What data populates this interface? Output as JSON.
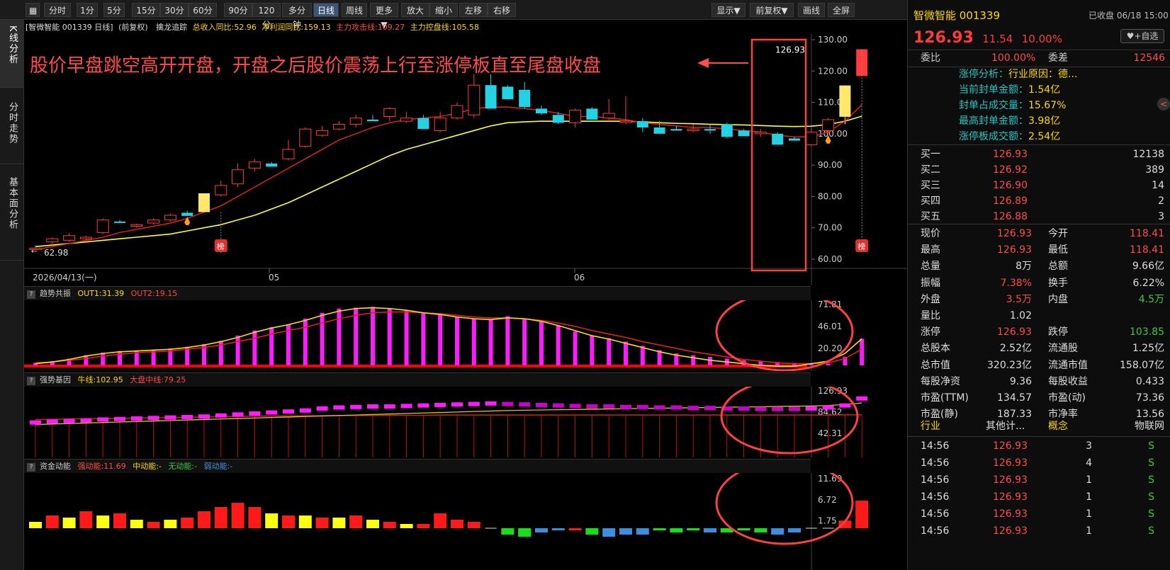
{
  "toolbar": {
    "buttons": [
      "分时",
      "1分",
      "5分",
      "15分",
      "30分",
      "60分",
      "90分",
      "120分",
      "多分钟",
      "日线",
      "周线",
      "更多▼",
      "放大",
      "缩小",
      "左移",
      "右移"
    ],
    "right_buttons": [
      "显示▼",
      "前复权▼",
      "画线",
      "全屏"
    ]
  },
  "nav": {
    "items": [
      "K线分析",
      "分时走势",
      "基本面分析"
    ]
  },
  "main_panel": {
    "info_label": "[智微智能 001339 日线]",
    "fuquan": "(前复权)",
    "indicator_name": "擒龙追踪",
    "ind1": "总收入同比:52.96",
    "ind2": "净利润同比:159.13",
    "ind3": "主力攻击线:109.27",
    "ind4": "主力控盘线:105.58",
    "annotation": "股价早盘跳空高开开盘，开盘之后股价震荡上行至涨停板直至尾盘收盘",
    "last_price_tag": "126.93",
    "low_tag": "62.98",
    "bang": "榜",
    "y_labels": [
      "130.00",
      "120.00",
      "110.00",
      "100.00",
      "90.00",
      "80.00",
      "70.00",
      "60.00"
    ],
    "x_labels": [
      "2026/04/13(一)",
      "05",
      "06"
    ]
  },
  "panel2": {
    "name": "趋势共振",
    "v1": "OUT1:31.39",
    "v2": "OUT2:19.15",
    "y_labels": [
      "71.81",
      "46.01",
      "20.20"
    ]
  },
  "panel3": {
    "name": "强势基因",
    "v1": "牛线:102.95",
    "v2": "大盘中线:79.25",
    "y_labels": [
      "126.93",
      "84.62",
      "42.31"
    ]
  },
  "panel4": {
    "name": "资金动能",
    "v1": "强动能:11.69",
    "v2": "中动能:-",
    "v3": "无动能:-",
    "v4": "弱动能:-",
    "y_labels": [
      "11.69",
      "6.72",
      "1.75"
    ]
  },
  "right": {
    "name": "智微智能",
    "code": "001339",
    "status": "已收盘 06/18 15:00",
    "price": "126.93",
    "change": "11.54",
    "pct": "10.00%",
    "add_btn": "+自选",
    "weibi_label": "委比",
    "weibi": "100.00%",
    "weicha_label": "委差",
    "weicha": "12546",
    "limit_analysis": [
      {
        "label": "涨停分析：",
        "value": "行业原因：德..."
      },
      {
        "label": "当前封单金额：",
        "value": "1.54亿"
      },
      {
        "label": "封单占成交量：",
        "value": "15.67%"
      },
      {
        "label": "最高封单金额：",
        "value": "3.98亿"
      },
      {
        "label": "涨停板成交额：",
        "value": "2.54亿"
      }
    ],
    "bids": [
      {
        "label": "买一",
        "price": "126.93",
        "vol": "12138"
      },
      {
        "label": "买二",
        "price": "126.92",
        "vol": "389"
      },
      {
        "label": "买三",
        "price": "126.90",
        "vol": "14"
      },
      {
        "label": "买四",
        "price": "126.89",
        "vol": "2"
      },
      {
        "label": "买五",
        "price": "126.88",
        "vol": "3"
      }
    ],
    "quotes": [
      {
        "l1": "现价",
        "v1": "126.93",
        "c1": "red",
        "l2": "今开",
        "v2": "118.41",
        "c2": "red"
      },
      {
        "l1": "最高",
        "v1": "126.93",
        "c1": "red",
        "l2": "最低",
        "v2": "118.41",
        "c2": "red"
      },
      {
        "l1": "总量",
        "v1": "8万",
        "c1": "wht",
        "l2": "总额",
        "v2": "9.66亿",
        "c2": "wht"
      },
      {
        "l1": "振幅",
        "v1": "7.38%",
        "c1": "red",
        "l2": "换手",
        "v2": "6.22%",
        "c2": "wht"
      },
      {
        "l1": "外盘",
        "v1": "3.5万",
        "c1": "red",
        "l2": "内盘",
        "v2": "4.5万",
        "c2": "grn"
      },
      {
        "l1": "量比",
        "v1": "1.02",
        "c1": "wht",
        "l2": "",
        "v2": "",
        "c2": "wht"
      },
      {
        "l1": "涨停",
        "v1": "126.93",
        "c1": "red",
        "l2": "跌停",
        "v2": "103.85",
        "c2": "grn"
      },
      {
        "l1": "总股本",
        "v1": "2.52亿",
        "c1": "wht",
        "l2": "流通股",
        "v2": "1.25亿",
        "c2": "wht"
      },
      {
        "l1": "总市值",
        "v1": "320.23亿",
        "c1": "wht",
        "l2": "流通市值",
        "v2": "158.07亿",
        "c2": "wht"
      },
      {
        "l1": "每股净资",
        "v1": "9.36",
        "c1": "wht",
        "l2": "每股收益",
        "v2": "0.433",
        "c2": "wht"
      },
      {
        "l1": "市盈(TTM)",
        "v1": "134.57",
        "c1": "wht",
        "l2": "市盈(动)",
        "v2": "73.36",
        "c2": "wht"
      },
      {
        "l1": "市盈(静)",
        "v1": "187.33",
        "c1": "wht",
        "l2": "市净率",
        "v2": "13.56",
        "c2": "wht"
      }
    ],
    "industry": {
      "l1": "行业",
      "v1": "其他计...",
      "l2": "概念",
      "v2": "物联网"
    },
    "ticks": [
      {
        "t": "14:56",
        "p": "126.93",
        "v": "3",
        "s": "S"
      },
      {
        "t": "14:56",
        "p": "126.93",
        "v": "4",
        "s": "S"
      },
      {
        "t": "14:56",
        "p": "126.93",
        "v": "1",
        "s": "S"
      },
      {
        "t": "14:56",
        "p": "126.93",
        "v": "1",
        "s": "S"
      },
      {
        "t": "14:56",
        "p": "126.93",
        "v": "1",
        "s": "S"
      },
      {
        "t": "14:56",
        "p": "126.93",
        "v": "1",
        "s": "S"
      }
    ]
  },
  "colors": {
    "up": "#ff3b3b",
    "down": "#22d3e6",
    "limit": "#ffe86a",
    "ma": "#ffff2a",
    "ma2": "#cc2222",
    "magenta": "#ff1aff",
    "annot": "#ff4b4b"
  },
  "chart_data": [
    {
      "type": "candlestick",
      "title": "智微智能 001339 日线",
      "y_range": [
        60,
        130
      ],
      "ohlc": [
        [
          63.5,
          62.98,
          63.5,
          64.5
        ],
        [
          65.5,
          64,
          66.5,
          67
        ],
        [
          66,
          65.5,
          67.5,
          68.3
        ],
        [
          66.5,
          66,
          67,
          67.5
        ],
        [
          68.5,
          68,
          72.5,
          73
        ],
        [
          72,
          71.5,
          71.8,
          72.5
        ],
        [
          70.5,
          70,
          71,
          71.3
        ],
        [
          71.5,
          71,
          72.5,
          73
        ],
        [
          72.5,
          72,
          74,
          74.5
        ],
        [
          74.8,
          74,
          73.8,
          75.5
        ],
        [
          75,
          75,
          81,
          81
        ],
        [
          80.5,
          80,
          83.5,
          85
        ],
        [
          84,
          83,
          88.5,
          90.5
        ],
        [
          89,
          88,
          91,
          92
        ],
        [
          90.5,
          90,
          89.5,
          91
        ],
        [
          92,
          91.5,
          95,
          98
        ],
        [
          96,
          95.5,
          101.5,
          102
        ],
        [
          99.5,
          99,
          101,
          102.5
        ],
        [
          101.5,
          101,
          103,
          104
        ],
        [
          103,
          102,
          105,
          106
        ],
        [
          104.5,
          104,
          104,
          106
        ],
        [
          105.5,
          104,
          108,
          108.5
        ],
        [
          104,
          103.5,
          105,
          107
        ],
        [
          105,
          103,
          101.5,
          106
        ],
        [
          101,
          100.5,
          105,
          107
        ],
        [
          105,
          104.5,
          109,
          110
        ],
        [
          106,
          105,
          115.5,
          119
        ],
        [
          115.5,
          108,
          108,
          119
        ],
        [
          115,
          114,
          111,
          115.5
        ],
        [
          114,
          108,
          108.5,
          116.5
        ],
        [
          108,
          106,
          106.5,
          109
        ],
        [
          106,
          103,
          103.5,
          107
        ],
        [
          103.5,
          102,
          107.5,
          108
        ],
        [
          108,
          104.5,
          104.5,
          108.5
        ],
        [
          105,
          104,
          106.5,
          111
        ],
        [
          104,
          103,
          104,
          112
        ],
        [
          104,
          100.5,
          102,
          105
        ],
        [
          102,
          100,
          100,
          104
        ],
        [
          101.5,
          101,
          101,
          102.5
        ],
        [
          101,
          100.5,
          101.5,
          103
        ],
        [
          101.5,
          100,
          101,
          103
        ],
        [
          103,
          98.5,
          99,
          103.5
        ],
        [
          101,
          100.5,
          99.2,
          101.5
        ],
        [
          100,
          99,
          100.5,
          101.5
        ],
        [
          100,
          96.5,
          96.5,
          100.5
        ],
        [
          98.5,
          98,
          97.8,
          99
        ],
        [
          96.5,
          96,
          100.5,
          102
        ],
        [
          101,
          100,
          104.5,
          105
        ],
        [
          105.4,
          103,
          115.39,
          115.39
        ],
        [
          118.41,
          118.41,
          126.93,
          126.93
        ]
      ],
      "ma_attack": [
        63,
        64,
        65,
        66,
        67,
        68.5,
        69.5,
        70.5,
        71.5,
        73,
        75,
        77,
        80,
        83,
        86,
        89,
        92,
        95,
        98,
        100,
        102,
        103.5,
        104.5,
        105,
        105.5,
        106.5,
        108,
        108.5,
        108.5,
        108,
        107.5,
        106.5,
        105.5,
        105.5,
        105,
        104.5,
        103.5,
        103,
        102.5,
        102,
        102,
        101.5,
        101,
        100.5,
        99.5,
        99,
        99,
        100.5,
        104,
        109.27
      ],
      "ma_control": [
        64,
        64.5,
        65,
        65.5,
        66,
        66.5,
        67,
        67.5,
        68,
        69,
        70,
        71,
        72.5,
        74,
        76,
        78,
        80.5,
        83,
        85.5,
        88,
        90.5,
        93,
        95,
        96.5,
        98,
        99.5,
        101,
        102.5,
        103.5,
        103.8,
        104,
        104,
        104,
        104,
        104,
        104,
        103.8,
        103.5,
        103.3,
        103.2,
        103,
        102.9,
        102.8,
        102.6,
        102.4,
        102.3,
        102.4,
        102.9,
        104,
        105.58
      ]
    },
    {
      "type": "bar",
      "title": "趋势共振",
      "y_range": [
        0,
        71.81
      ],
      "bars": [
        3,
        5,
        8,
        12,
        15,
        17,
        17,
        18,
        20,
        22,
        25,
        29,
        35,
        41,
        45,
        48,
        55,
        62,
        67,
        68,
        69,
        67,
        65,
        62,
        60,
        57,
        55,
        54,
        58,
        55,
        52,
        47,
        40,
        35,
        32,
        28,
        23,
        18,
        14,
        12,
        10,
        8,
        6,
        5,
        4,
        3,
        2,
        2,
        10,
        31.39
      ],
      "out1": [
        2,
        4,
        7,
        11,
        14,
        16,
        17,
        18,
        19,
        21,
        24,
        28,
        33,
        39,
        44,
        48,
        53,
        59,
        64,
        67,
        68,
        67,
        65,
        62,
        60,
        57,
        55,
        54,
        56,
        55,
        52,
        47,
        41,
        35,
        31,
        26,
        21,
        16,
        12,
        9,
        6,
        4,
        2,
        0,
        -1,
        -1,
        2,
        5,
        14,
        31.39
      ],
      "out2": [
        3,
        4,
        6,
        8,
        11,
        13,
        15,
        16,
        17,
        19,
        21,
        24,
        28,
        32,
        37,
        41,
        45,
        50,
        55,
        59,
        62,
        63,
        63,
        62,
        61,
        59,
        57,
        56,
        56,
        55,
        53,
        50,
        46,
        41,
        37,
        33,
        28,
        24,
        20,
        16,
        13,
        10,
        7,
        5,
        3,
        2,
        2,
        3,
        8,
        19.15
      ]
    },
    {
      "type": "bar",
      "title": "强势基因",
      "y_range": [
        0,
        130
      ],
      "blocks": [
        64,
        66,
        67,
        68,
        70,
        71,
        72,
        73,
        74,
        75,
        76,
        78,
        80,
        82,
        84,
        86,
        88,
        92,
        94,
        95,
        96,
        96,
        97,
        98,
        99,
        100,
        101,
        102,
        101,
        100,
        99,
        98,
        97,
        96,
        96,
        95,
        95,
        94,
        94,
        93,
        93,
        92,
        92,
        91,
        91,
        91,
        92,
        94,
        98,
        112
      ],
      "bull_line": [
        60,
        61,
        62,
        63,
        64,
        65,
        66,
        67,
        68,
        69,
        70,
        71,
        72,
        73,
        74,
        75,
        76,
        77,
        78,
        79,
        80,
        81,
        82,
        83,
        84,
        85,
        86,
        87,
        88,
        88.5,
        89,
        89.5,
        90,
        90.5,
        91,
        91.5,
        92,
        92.5,
        93,
        93.5,
        94,
        94.5,
        95,
        95.5,
        96,
        96.5,
        97,
        98,
        100,
        102.95
      ],
      "market_line": [
        70,
        70.5,
        71,
        71.5,
        72,
        72.5,
        73,
        73.5,
        74,
        74.5,
        75,
        75.5,
        76,
        76.5,
        77,
        77,
        77.5,
        77.5,
        78,
        78,
        78,
        78.5,
        78.5,
        78.5,
        79,
        79,
        79,
        79,
        79,
        79,
        79,
        79,
        79,
        79,
        79,
        79,
        79,
        79,
        79,
        79,
        79,
        79,
        79,
        79,
        79,
        79,
        79,
        79,
        79.25,
        79.25
      ]
    },
    {
      "type": "bar",
      "title": "资金动能",
      "y_range": [
        -3,
        12
      ],
      "values": [
        1.5,
        3,
        2.5,
        4,
        3,
        3.5,
        2,
        1.5,
        2,
        2.5,
        4,
        5,
        6,
        5,
        3.5,
        3,
        3,
        2.5,
        2.5,
        3,
        2,
        1.5,
        1,
        1,
        3.5,
        2,
        1.5,
        0,
        -1.5,
        -2,
        -1,
        -0.5,
        -0.5,
        -1.5,
        -2,
        -1.5,
        -1.5,
        -0.5,
        -1,
        -0.5,
        -1,
        -1,
        -0.5,
        -1,
        -1.5,
        -1,
        0,
        0,
        1.8,
        6.5
      ],
      "colors": [
        "y",
        "r",
        "y",
        "r",
        "y",
        "r",
        "y",
        "r",
        "y",
        "r",
        "r",
        "r",
        "r",
        "r",
        "y",
        "r",
        "y",
        "r",
        "y",
        "r",
        "y",
        "r",
        "y",
        "r",
        "r",
        "r",
        "r",
        "w",
        "g",
        "g",
        "b",
        "b",
        "r",
        "g",
        "b",
        "b",
        "b",
        "g",
        "g",
        "g",
        "b",
        "g",
        "g",
        "g",
        "b",
        "b",
        "w",
        "w",
        "r",
        "r"
      ]
    }
  ]
}
